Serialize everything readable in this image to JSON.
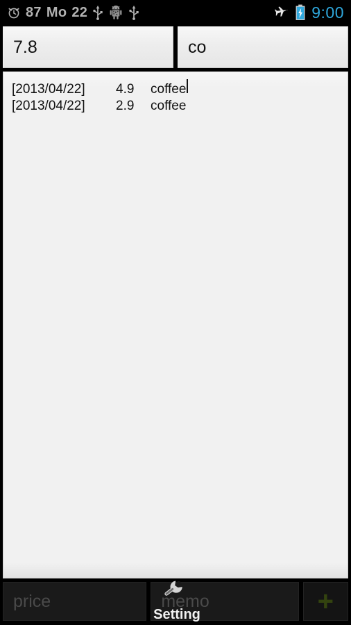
{
  "statusbar": {
    "alarm_icon": "alarm-clock-icon",
    "battery_percent": "87",
    "day": "Mo",
    "date": "22",
    "usb_icon_1": "usb-icon",
    "android_icon": "android-robot-icon",
    "usb_icon_2": "usb-icon",
    "airplane_icon": "airplane-mode-icon",
    "battery_icon": "battery-charging-icon",
    "clock": "9:00",
    "clock_color": "#2fa8dd",
    "text_color": "#b3b3b3"
  },
  "top_inputs": {
    "price_field": {
      "value": "7.8",
      "placeholder": ""
    },
    "memo_field": {
      "value": "co",
      "placeholder": ""
    }
  },
  "list": {
    "rows": [
      {
        "date": "[2013/04/22]",
        "price": "4.9",
        "memo": "coffee",
        "has_caret": true
      },
      {
        "date": "[2013/04/22]",
        "price": "2.9",
        "memo": "coffee",
        "has_caret": false
      }
    ]
  },
  "bottom_bar": {
    "price_input": {
      "value": "",
      "placeholder": "price"
    },
    "memo_input": {
      "value": "",
      "placeholder": "memo"
    },
    "add_button": {
      "label": "+",
      "color": "#33430f"
    }
  },
  "setting_overlay": {
    "icon": "wrench-icon",
    "label": "Setting"
  }
}
